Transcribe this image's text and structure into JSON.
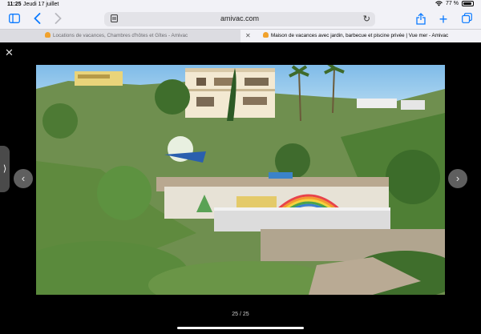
{
  "status_bar": {
    "time": "11:25",
    "date": "Jeudi 17 juillet",
    "battery": "77 %"
  },
  "toolbar": {
    "url": "amivac.com"
  },
  "tabs": [
    {
      "title": "Locations de vacances, Chambres d'hôtes et Gîtes - Amivac",
      "active": false
    },
    {
      "title": "Maison de vacances avec jardin, barbecue et piscine privée | Vue mer - Amivac",
      "active": true
    }
  ],
  "lightbox": {
    "counter": "25 / 25"
  },
  "colors": {
    "accent": "#0a7aff",
    "favicon": "#f1a22d",
    "sky": "#8fc3ea"
  },
  "icons": [
    "wifi-icon",
    "battery-icon",
    "sidebar-icon",
    "back-icon",
    "forward-icon",
    "page-icon",
    "reload-icon",
    "share-icon",
    "new-tab-icon",
    "tabs-icon",
    "close-icon",
    "chevron-left-icon",
    "chevron-right-icon"
  ]
}
